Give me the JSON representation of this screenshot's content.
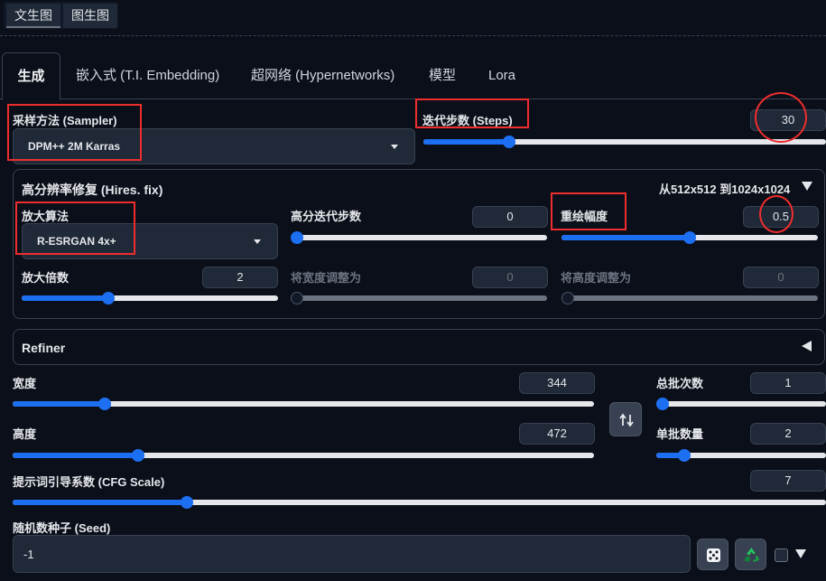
{
  "mode_tabs": [
    "文生图",
    "图生图"
  ],
  "tabs": [
    "生成",
    "嵌入式 (T.I. Embedding)",
    "超网络 (Hypernetworks)",
    "模型",
    "Lora"
  ],
  "sampler": {
    "label": "采样方法 (Sampler)",
    "value": "DPM++ 2M Karras"
  },
  "steps": {
    "label": "迭代步数 (Steps)",
    "value": "30",
    "fraction": 0.203
  },
  "hires": {
    "title": "高分辨率修复 (Hires. fix)",
    "resolution": "从512x512 到1024x1024",
    "upscaler": {
      "label": "放大算法",
      "value": "R-ESRGAN 4x+"
    },
    "hires_steps": {
      "label": "高分迭代步数",
      "value": "0",
      "fraction": 0.0
    },
    "denoise": {
      "label": "重绘幅度",
      "value": "0.5",
      "fraction": 0.5
    },
    "upscale_by": {
      "label": "放大倍数",
      "value": "2",
      "fraction": 0.33
    },
    "resize_w": {
      "label": "将宽度调整为",
      "value": "0",
      "fraction": 0.0
    },
    "resize_h": {
      "label": "将高度调整为",
      "value": "0",
      "fraction": 0.0
    }
  },
  "refiner": {
    "label": "Refiner"
  },
  "width": {
    "label": "宽度",
    "value": "344",
    "fraction": 0.15
  },
  "height": {
    "label": "高度",
    "value": "472",
    "fraction": 0.21
  },
  "batch_count": {
    "label": "总批次数",
    "value": "1",
    "fraction": 0.0
  },
  "batch_size": {
    "label": "单批数量",
    "value": "2",
    "fraction": 0.14
  },
  "cfg": {
    "label": "提示词引导系数 (CFG Scale)",
    "value": "7",
    "fraction": 0.21
  },
  "seed": {
    "label": "随机数种子 (Seed)",
    "value": "-1"
  },
  "colors": {
    "accent": "#1d6ff2",
    "highlight": "#ef2d2d",
    "background": "#0b0f19"
  },
  "icons": [
    "swap-icon",
    "dice-icon",
    "recycle-icon",
    "triangle-down-icon",
    "triangle-left-icon",
    "caret-down-icon"
  ]
}
